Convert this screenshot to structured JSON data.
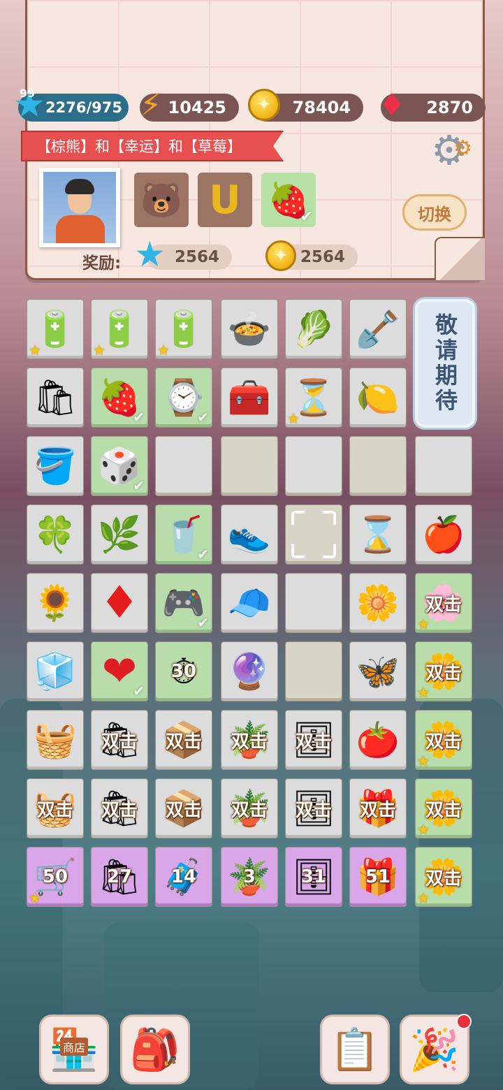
{
  "header": {
    "xp": {
      "level": "99",
      "value": "2276/975",
      "icon": "blue-star-icon"
    },
    "energy": {
      "value": "10425",
      "icon": "lightning-icon"
    },
    "coins": {
      "value": "78404",
      "icon": "coin-icon"
    },
    "gems": {
      "value": "2870",
      "icon": "ruby-icon"
    }
  },
  "quest": {
    "banner": "【棕熊】和【幸运】和【草莓】",
    "items": [
      {
        "name": "brown-bear",
        "glyph": "🐻",
        "done": false
      },
      {
        "name": "horseshoe",
        "glyph": "🧲",
        "done": false
      },
      {
        "name": "strawberry",
        "glyph": "🍓",
        "done": true
      }
    ],
    "switch_label": "切换",
    "reward_label": "奖励:",
    "reward_stars": "2564",
    "reward_coins": "2564"
  },
  "board": {
    "coming_soon": "敬请期待",
    "double_label": "双击",
    "rows": [
      [
        {
          "icon": "battery-icon",
          "glyph": "🔋",
          "bg": "g",
          "star": true
        },
        {
          "icon": "battery-icon",
          "glyph": "🔋",
          "bg": "g",
          "star": true
        },
        {
          "icon": "battery-icon",
          "glyph": "🔋",
          "bg": "g",
          "star": true
        },
        {
          "icon": "rice-cooker-icon",
          "glyph": "🍲",
          "bg": "g"
        },
        {
          "icon": "lettuce-icon",
          "glyph": "🥬",
          "bg": "g"
        },
        {
          "icon": "shovel-icon",
          "glyph": "🪏",
          "bg": "g"
        }
      ],
      [
        {
          "icon": "paper-bag-icon",
          "glyph": "🛍",
          "bg": "g"
        },
        {
          "icon": "strawberry-icon",
          "glyph": "🍓",
          "bg": "gr",
          "check": true
        },
        {
          "icon": "smartwatch-icon",
          "glyph": "⌚",
          "bg": "gr",
          "check": true
        },
        {
          "icon": "treasure-chest-icon",
          "glyph": "🧰",
          "bg": "g"
        },
        {
          "icon": "hourglass-gold-icon",
          "glyph": "⏳",
          "bg": "g",
          "star": true
        },
        {
          "icon": "lemon-icon",
          "glyph": "🍋",
          "bg": "g"
        }
      ],
      [
        {
          "icon": "cleaning-bucket-icon",
          "glyph": "🪣",
          "bg": "g"
        },
        {
          "icon": "dice-icon",
          "glyph": "🎲",
          "bg": "gr",
          "check": true
        },
        {
          "icon": "",
          "glyph": "",
          "bg": "emptyg"
        },
        {
          "icon": "",
          "glyph": "",
          "bg": "empty"
        },
        {
          "icon": "",
          "glyph": "",
          "bg": "emptyg"
        },
        {
          "icon": "",
          "glyph": "",
          "bg": "empty"
        },
        {
          "icon": "",
          "glyph": "",
          "bg": "emptyg"
        }
      ],
      [
        {
          "icon": "four-leaf-clover-icon",
          "glyph": "🍀",
          "bg": "g"
        },
        {
          "icon": "seed-packet-icon",
          "glyph": "🌿",
          "bg": "g"
        },
        {
          "icon": "blender-icon",
          "glyph": "🥤",
          "bg": "gr",
          "check": true
        },
        {
          "icon": "sneakers-icon",
          "glyph": "👟",
          "bg": "g"
        },
        {
          "icon": "selection-frame-icon",
          "glyph": "",
          "bg": "empty",
          "select": true
        },
        {
          "icon": "hourglass-blue-icon",
          "glyph": "⌛",
          "bg": "g"
        },
        {
          "icon": "apple-icon",
          "glyph": "🍎",
          "bg": "g"
        }
      ],
      [
        {
          "icon": "seed-packet-sunflower-icon",
          "glyph": "🌻",
          "bg": "g"
        },
        {
          "icon": "red-diamond-icon",
          "glyph": "♦",
          "bg": "g"
        },
        {
          "icon": "gamepad-icon",
          "glyph": "🎮",
          "bg": "gr",
          "check": true
        },
        {
          "icon": "baseball-cap-icon",
          "glyph": "🧢",
          "bg": "g"
        },
        {
          "icon": "",
          "glyph": "",
          "bg": "emptyg"
        },
        {
          "icon": "daisy-icon",
          "glyph": "🌼",
          "bg": "g"
        },
        {
          "icon": "flower-box-icon",
          "glyph": "🌸",
          "bg": "gr",
          "star": true,
          "double": true
        }
      ],
      [
        {
          "icon": "cooler-box-icon",
          "glyph": "🧊",
          "bg": "g"
        },
        {
          "icon": "heart-icon",
          "glyph": "❤",
          "bg": "gr",
          "check": true
        },
        {
          "icon": "timer-30-icon",
          "glyph": "⏱",
          "bg": "gr",
          "num": "30"
        },
        {
          "icon": "magic-potion-icon",
          "glyph": "🔮",
          "bg": "g"
        },
        {
          "icon": "",
          "glyph": "",
          "bg": "empty"
        },
        {
          "icon": "butterfly-icon",
          "glyph": "🦋",
          "bg": "g"
        },
        {
          "icon": "flower-box-icon",
          "glyph": "🌼",
          "bg": "gr",
          "star": true,
          "double": true
        }
      ],
      [
        {
          "icon": "basket-icon",
          "glyph": "🧺",
          "bg": "g"
        },
        {
          "icon": "shopping-bags-icon",
          "glyph": "🛍",
          "bg": "g",
          "double": true
        },
        {
          "icon": "grocery-box-icon",
          "glyph": "📦",
          "bg": "g",
          "double": true
        },
        {
          "icon": "soil-sack-icon",
          "glyph": "🪴",
          "bg": "g",
          "double": true
        },
        {
          "icon": "shelf-icon",
          "glyph": "🗄",
          "bg": "g",
          "double": true
        },
        {
          "icon": "tomato-icon",
          "glyph": "🍅",
          "bg": "g"
        },
        {
          "icon": "flower-box-icon",
          "glyph": "🌼",
          "bg": "gr",
          "star": true,
          "double": true
        }
      ],
      [
        {
          "icon": "grocery-basket-icon",
          "glyph": "🧺",
          "bg": "g",
          "double": true
        },
        {
          "icon": "shopping-bags-icon",
          "glyph": "🛍",
          "bg": "g",
          "double": true
        },
        {
          "icon": "grocery-box-icon",
          "glyph": "📦",
          "bg": "g",
          "double": true
        },
        {
          "icon": "flower-pot-icon",
          "glyph": "🪴",
          "bg": "g",
          "double": true
        },
        {
          "icon": "shelf-icon",
          "glyph": "🗄",
          "bg": "g",
          "double": true
        },
        {
          "icon": "gift-crate-icon",
          "glyph": "🎁",
          "bg": "g",
          "double": true
        },
        {
          "icon": "flower-box-icon",
          "glyph": "🌼",
          "bg": "gr",
          "star": true,
          "double": true
        }
      ],
      [
        {
          "icon": "shopping-cart-icon",
          "glyph": "🛒",
          "bg": "p",
          "star": true,
          "num": "50"
        },
        {
          "icon": "shopping-bags-icon",
          "glyph": "🛍",
          "bg": "p",
          "num": "27"
        },
        {
          "icon": "storage-box-icon",
          "glyph": "🧳",
          "bg": "p",
          "num": "14"
        },
        {
          "icon": "flower-pots-icon",
          "glyph": "🪴",
          "bg": "p",
          "num": "3"
        },
        {
          "icon": "shelf-icon",
          "glyph": "🗄",
          "bg": "p",
          "num": "31"
        },
        {
          "icon": "gift-crate-icon",
          "glyph": "🎁",
          "bg": "p",
          "num": "51"
        },
        {
          "icon": "flower-box-icon",
          "glyph": "🌼",
          "bg": "gr",
          "star": true,
          "double": true
        }
      ]
    ]
  },
  "bottom_nav": {
    "shop_label": "商店",
    "shop_icon": "shop-icon",
    "bag_icon": "backpack-icon",
    "tasks_icon": "clipboard-icon",
    "party_icon": "party-popper-icon"
  }
}
